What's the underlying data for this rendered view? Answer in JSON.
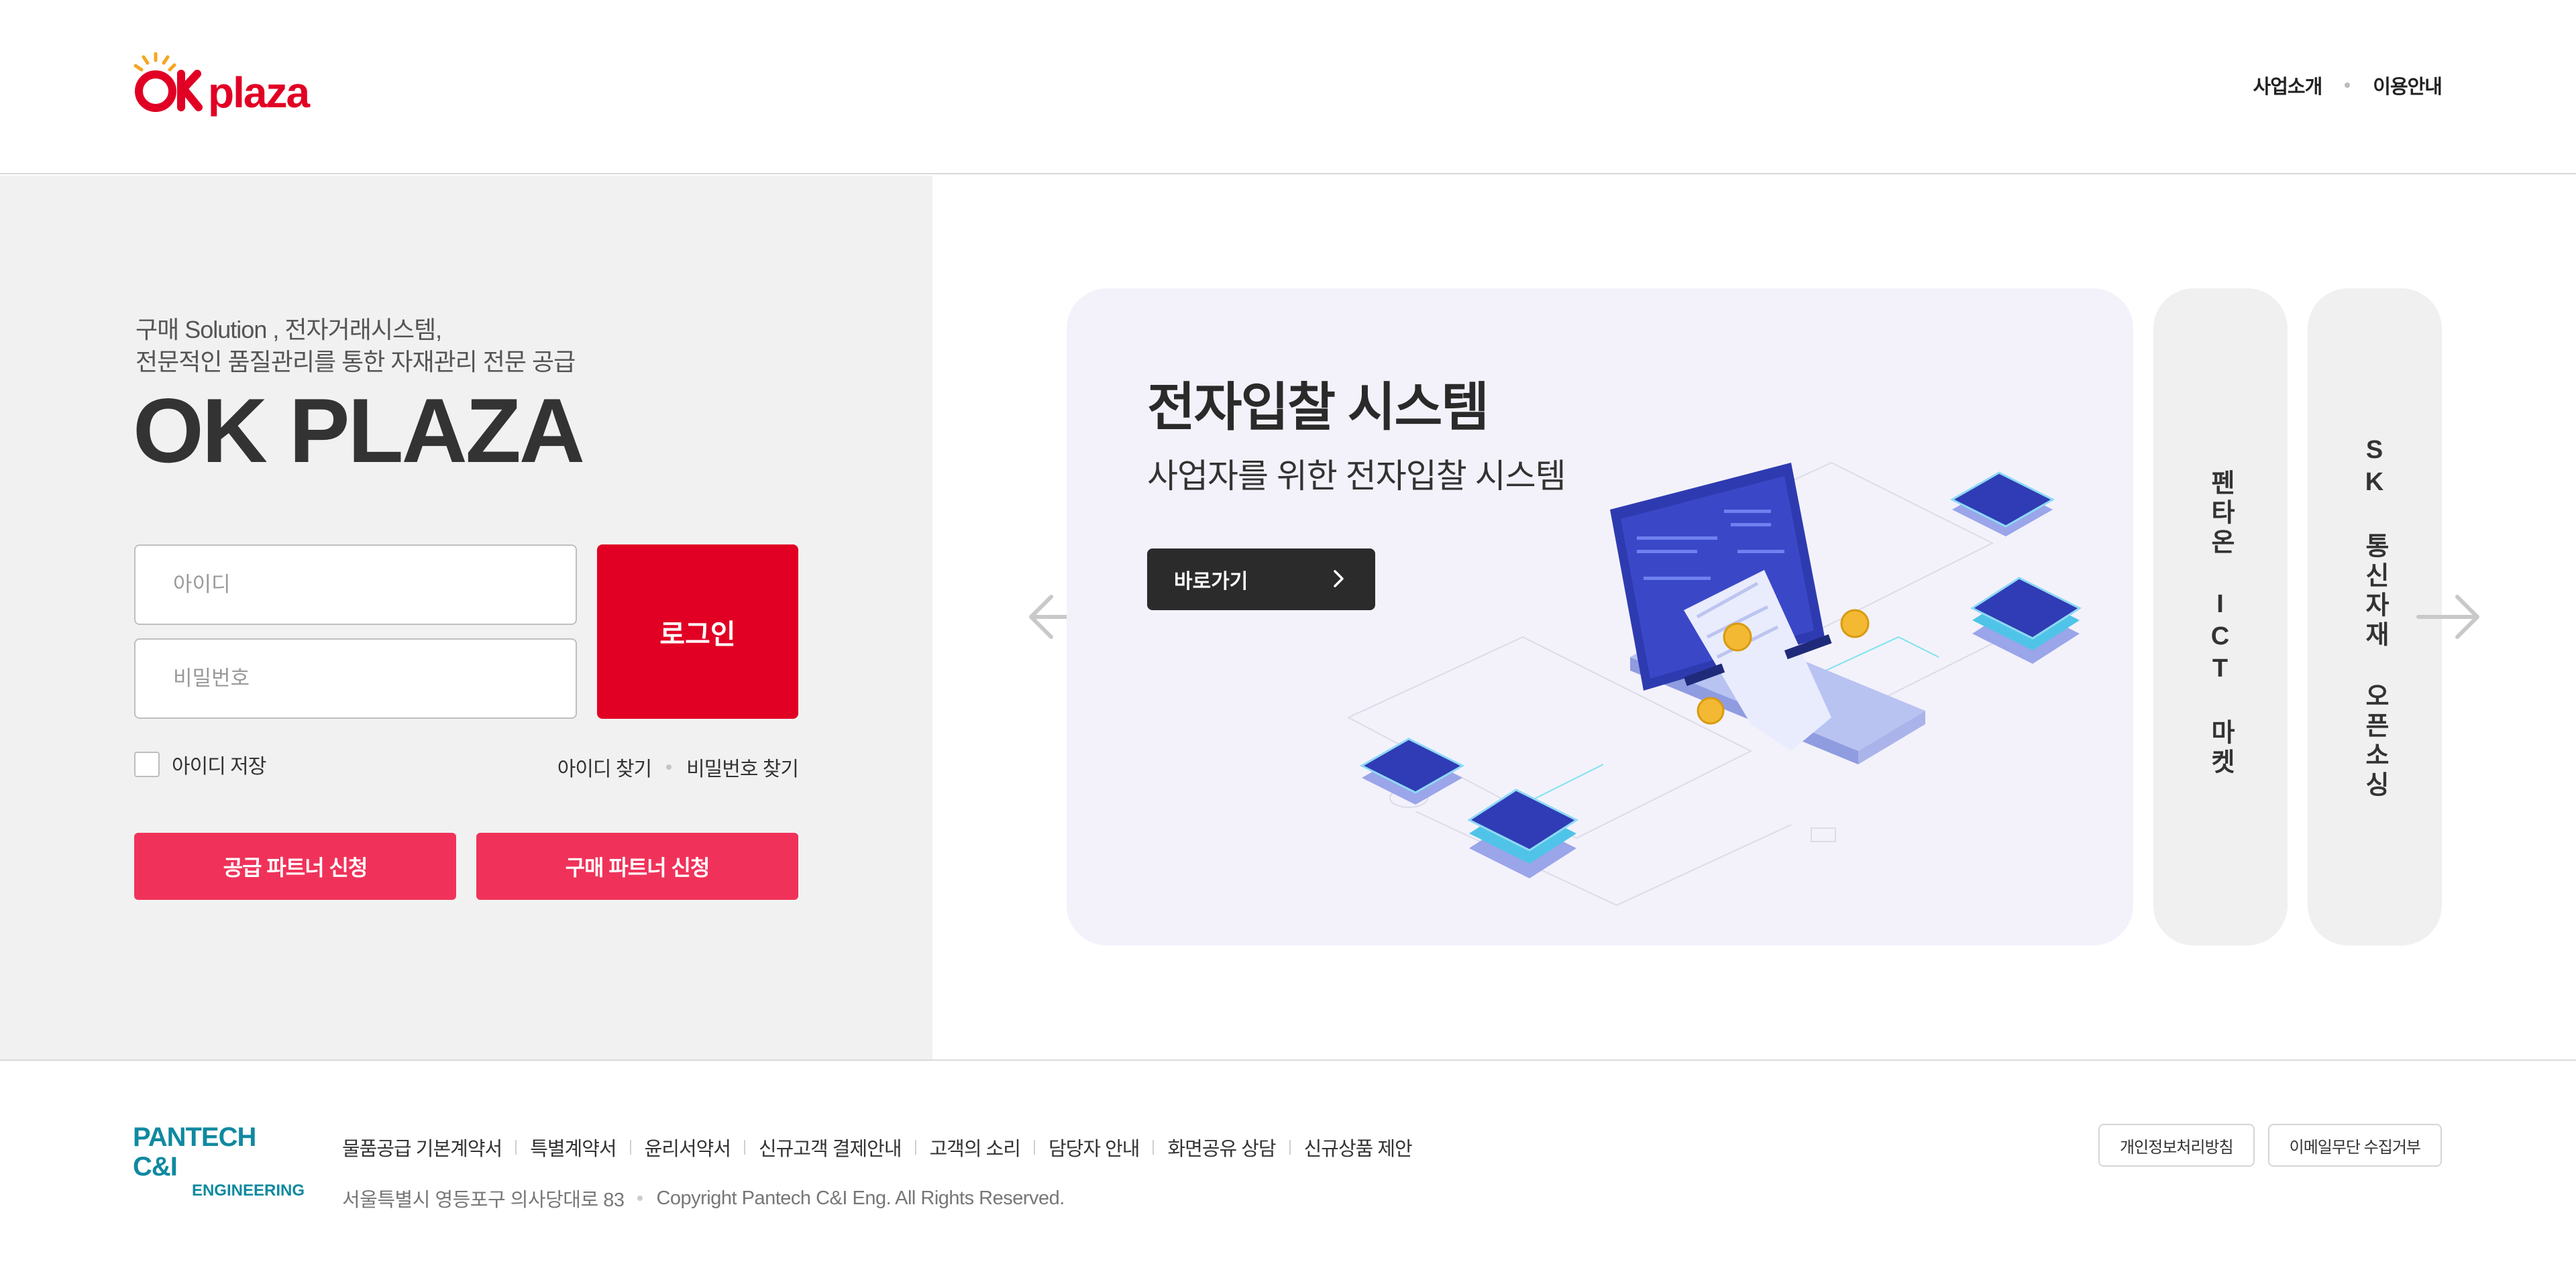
{
  "header": {
    "logo_text": "OK plaza",
    "nav": [
      {
        "label": "사업소개"
      },
      {
        "label": "이용안내"
      }
    ]
  },
  "login": {
    "tagline_line1": "구매 Solution , 전자거래시스템,",
    "tagline_line2": "전문적인 품질관리를 통한 자재관리 전문 공급",
    "brand": "OK PLAZA",
    "id_placeholder": "아이디",
    "id_value": "",
    "password_placeholder": "비밀번호",
    "password_value": "",
    "login_label": "로그인",
    "save_id_label": "아이디 저장",
    "save_id_checked": false,
    "find_id_label": "아이디 찾기",
    "find_password_label": "비밀번호 찾기",
    "supply_partner_label": "공급 파트너 신청",
    "buy_partner_label": "구매 파트너 신청"
  },
  "carousel": {
    "active": {
      "title": "전자입찰 시스템",
      "subtitle": "사업자를 위한 전자입찰 시스템",
      "button_label": "바로가기"
    },
    "side_cards": [
      {
        "label": "펜타온 ICT 마켓"
      },
      {
        "label": "SK 통신자재 오픈소싱"
      }
    ],
    "prev_icon": "arrow-left-icon",
    "next_icon": "arrow-right-icon"
  },
  "footer": {
    "logo_line1": "PANTECH C&I",
    "logo_line2": "ENGINEERING",
    "links": [
      {
        "label": "물품공급 기본계약서"
      },
      {
        "label": "특별계약서"
      },
      {
        "label": "윤리서약서"
      },
      {
        "label": "신규고객 결제안내"
      },
      {
        "label": "고객의 소리"
      },
      {
        "label": "담당자 안내"
      },
      {
        "label": "화면공유 상담"
      },
      {
        "label": "신규상품 제안"
      }
    ],
    "address": "서울특별시 영등포구 의사당대로 83",
    "copyright": "Copyright Pantech C&I Eng. All Rights Reserved.",
    "privacy_label": "개인정보처리방침",
    "email_refusal_label": "이메일무단 수집거부"
  },
  "colors": {
    "brand_red": "#e10024",
    "partner_pink": "#f0325a",
    "left_panel_bg": "#f1f1f1",
    "card_bg": "#f3f2fb",
    "footer_teal": "#0f89a0"
  }
}
